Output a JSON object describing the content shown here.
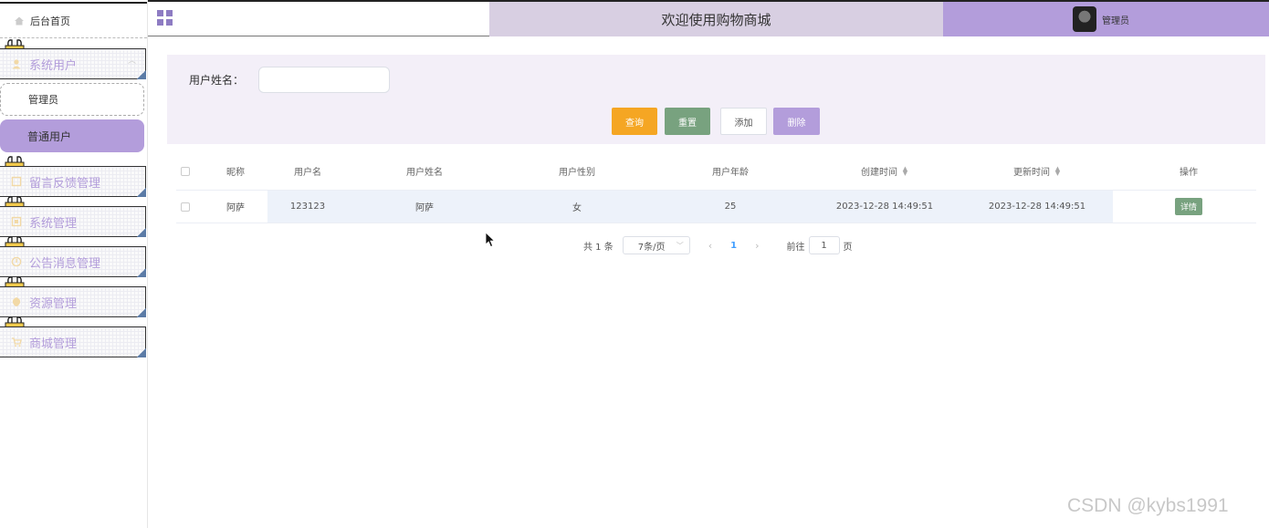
{
  "sidebar": {
    "home_label": "后台首页",
    "menu": [
      {
        "label": "系统用户",
        "icon": "user-icon"
      },
      {
        "label": "留言反馈管理",
        "icon": "note-icon"
      },
      {
        "label": "系统管理",
        "icon": "settings-icon"
      },
      {
        "label": "公告消息管理",
        "icon": "info-icon"
      },
      {
        "label": "资源管理",
        "icon": "resource-icon"
      },
      {
        "label": "商城管理",
        "icon": "cart-icon"
      }
    ],
    "submenu": [
      {
        "label": "管理员"
      },
      {
        "label": "普通用户"
      }
    ]
  },
  "header": {
    "title": "欢迎使用购物商城",
    "user": "管理员"
  },
  "search": {
    "label": "用户姓名：",
    "placeholder": "",
    "value": "",
    "buttons": {
      "query": "查询",
      "reset": "重置",
      "add": "添加",
      "delete": "删除"
    }
  },
  "table": {
    "columns": [
      "",
      "昵称",
      "用户名",
      "用户姓名",
      "用户性别",
      "用户年龄",
      "创建时间",
      "更新时间",
      "操作"
    ],
    "rows": [
      {
        "nickname": "阿萨",
        "username": "123123",
        "name": "阿萨",
        "gender": "女",
        "age": "25",
        "created": "2023-12-28 14:49:51",
        "updated": "2023-12-28 14:49:51",
        "action": "详情"
      }
    ]
  },
  "pagination": {
    "total": "共 1 条",
    "page_size": "7条/页",
    "current": "1",
    "goto_label": "前往",
    "goto_value": "1",
    "page_suffix": "页"
  },
  "watermark": "CSDN @kybs1991",
  "colors": {
    "accent_purple": "#b39ddb",
    "title_bg": "#d8cfe2",
    "panel_bg": "#f3eff8",
    "query_orange": "#f5a623",
    "reset_green": "#78a27f"
  }
}
